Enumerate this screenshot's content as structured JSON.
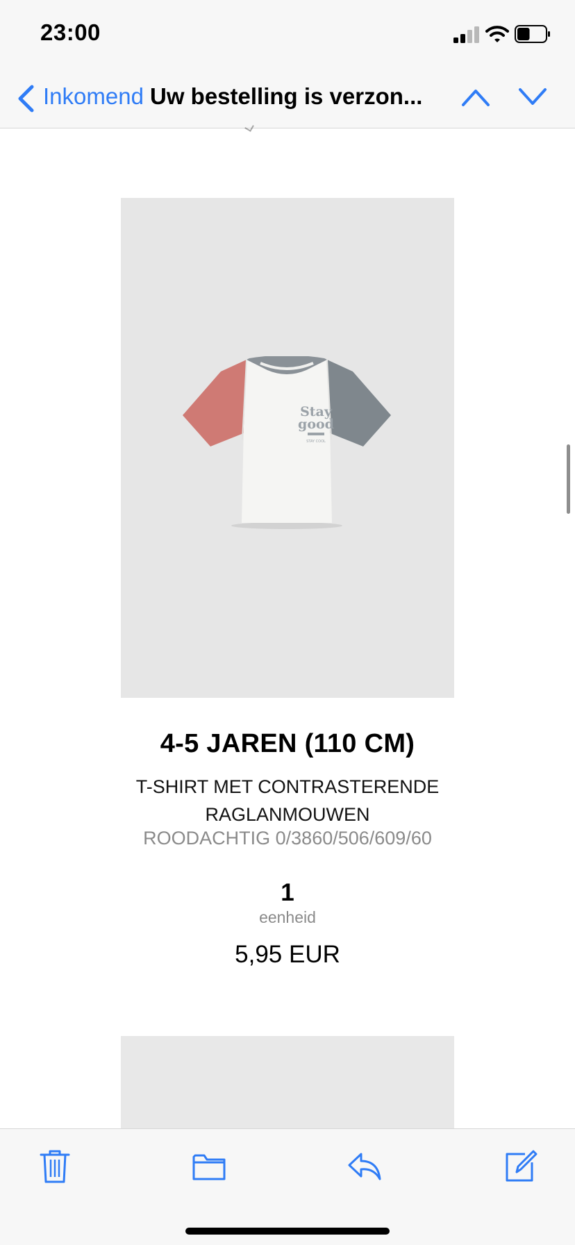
{
  "status_bar": {
    "time": "23:00",
    "signal_icon": "cellular-signal-icon",
    "wifi_icon": "wifi-icon",
    "battery_icon": "battery-icon",
    "battery_level": 0.45
  },
  "nav": {
    "back_label": "Inkomend",
    "title": "Uw bestelling is verzon...",
    "back_icon": "chevron-left-icon",
    "up_icon": "chevron-up-icon",
    "down_icon": "chevron-down-icon",
    "accent_color": "#2f7cf6"
  },
  "product": {
    "image_icon": "tshirt-product-image",
    "print_text_line1": "Stay",
    "print_text_line2": "good",
    "print_text_small": "STAY COOL",
    "size": "4-5 JAREN (110 CM)",
    "name": "T-SHIRT MET CONTRASTERENDE RAGLANMOUWEN",
    "reference": "ROODACHTIG 0/3860/506/609/60",
    "quantity": "1",
    "unit_label": "eenheid",
    "price": "5,95 EUR"
  },
  "toolbar": {
    "trash_icon": "trash-icon",
    "folder_icon": "folder-icon",
    "reply_icon": "reply-icon",
    "compose_icon": "compose-icon"
  }
}
